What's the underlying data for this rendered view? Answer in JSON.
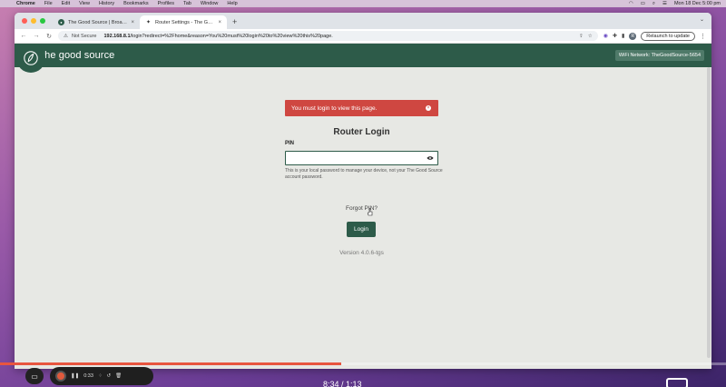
{
  "menubar": {
    "items": [
      "Chrome",
      "File",
      "Edit",
      "View",
      "History",
      "Bookmarks",
      "Profiles",
      "Tab",
      "Window",
      "Help"
    ],
    "clock": "Mon 18 Dec  5:00 pm"
  },
  "browser": {
    "tabs": [
      {
        "title": "The Good Source | Broadband",
        "close": "×"
      },
      {
        "title": "Router Settings - The Good S",
        "close": "×"
      }
    ],
    "new_tab": "+",
    "security_label": "Not Secure",
    "url_host": "192.168.8.1",
    "url_path": "/login?redirect=%2Fhome&reason=You%20must%20login%20to%20view%20this%20page.",
    "profile_initial": "R",
    "relaunch_label": "Relaunch to update"
  },
  "site": {
    "brand": "the good source",
    "wifi_badge": "WiFi Network: TheGoodSource-5654",
    "alert": "You must login to view this page.",
    "alert_close": "×",
    "title": "Router Login",
    "pin_label": "PIN",
    "pin_value": "",
    "help_text": "This is your local password to manage your device, not your The Good Source account password.",
    "forgot_label": "Forgot PIN?",
    "login_label": "Login",
    "version": "Version 4.0.6-tgs"
  },
  "video": {
    "elapsed": "0:33",
    "timecode": "8:34 / 1:13",
    "progress": 0.47
  },
  "colors": {
    "brand_green": "#2d5b49",
    "alert_red": "#cf4741",
    "progress_orange": "#e8553f"
  }
}
